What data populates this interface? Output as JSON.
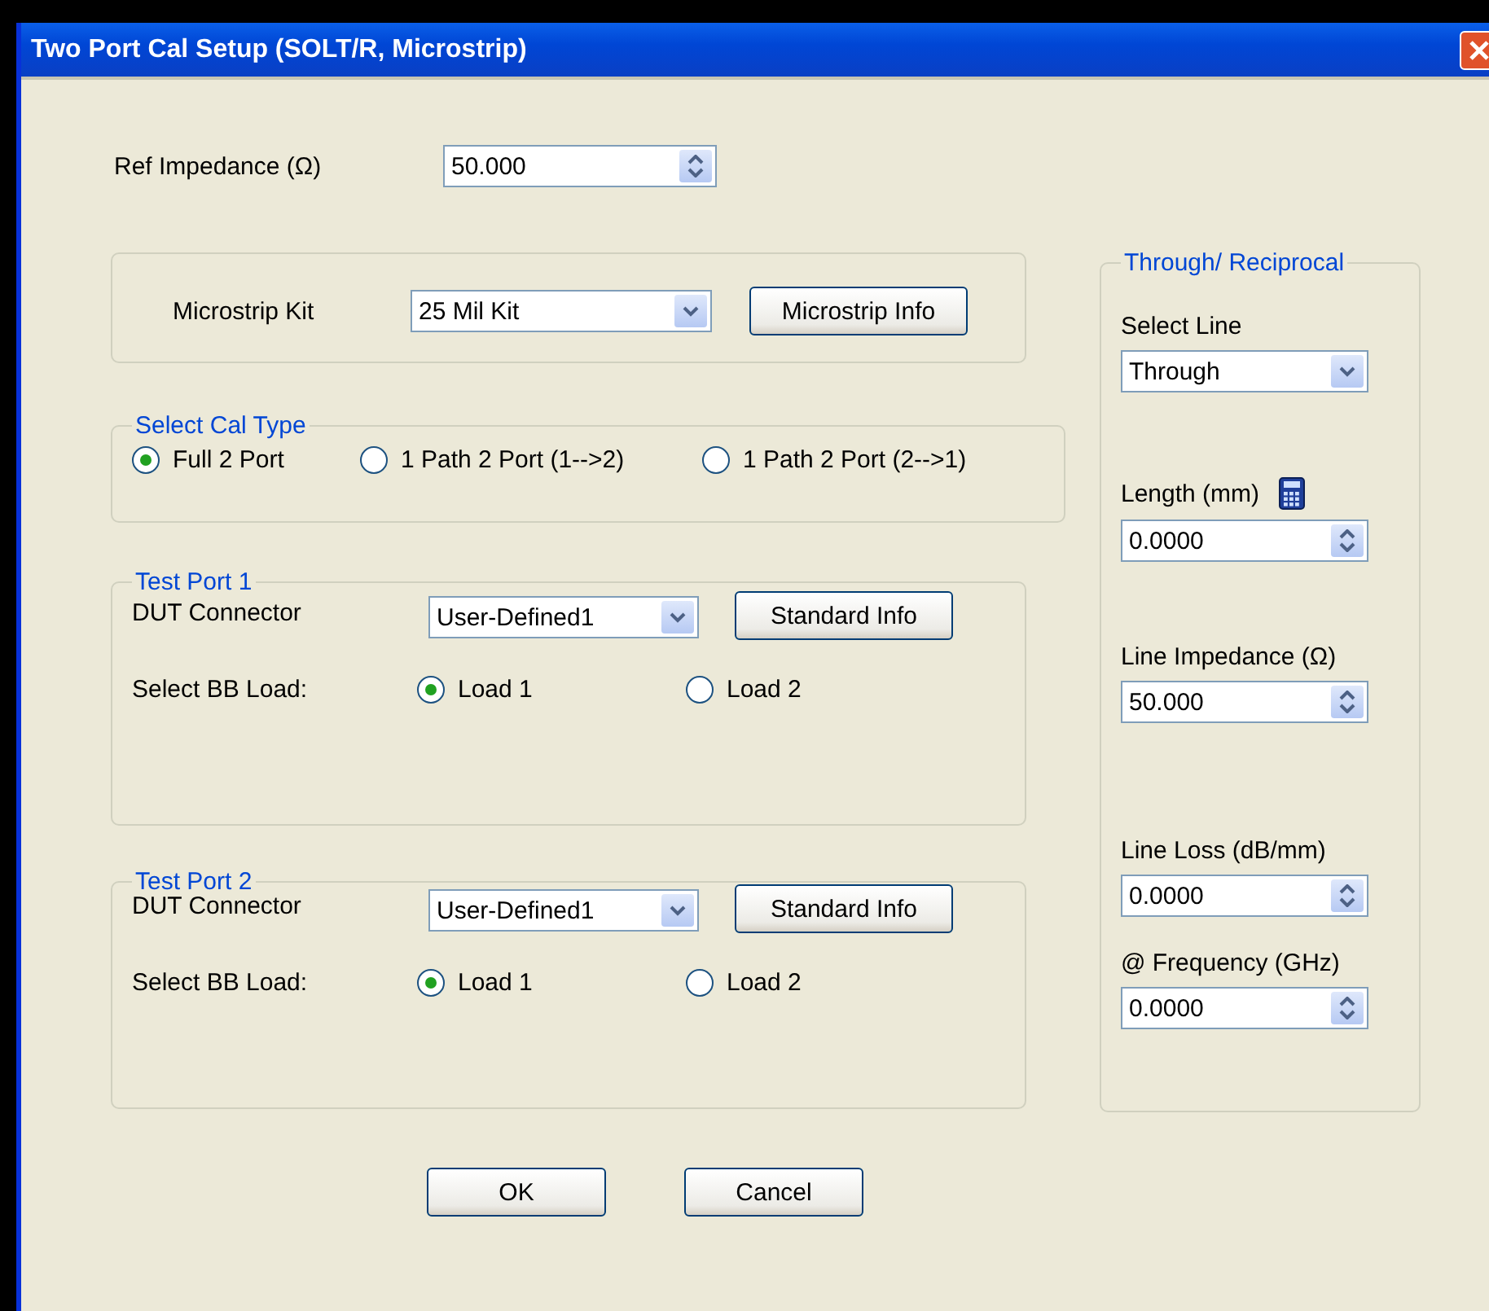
{
  "window": {
    "title": "Two Port Cal Setup (SOLT/R, Microstrip)"
  },
  "ref_impedance": {
    "label": "Ref Impedance (Ω)",
    "value": "50.000"
  },
  "microstrip": {
    "label": "Microstrip Kit",
    "value": "25 Mil Kit",
    "button": "Microstrip Info"
  },
  "cal_type": {
    "title": "Select Cal Type",
    "options": [
      {
        "label": "Full 2 Port",
        "selected": true
      },
      {
        "label": "1 Path 2 Port (1-->2)",
        "selected": false
      },
      {
        "label": "1 Path 2 Port (2-->1)",
        "selected": false
      }
    ]
  },
  "test_ports": [
    {
      "title": "Test Port 1",
      "connector_label": "DUT Connector",
      "connector": "User-Defined1",
      "button": "Standard Info",
      "load_label": "Select BB Load:",
      "loads": [
        {
          "label": "Load 1",
          "selected": true
        },
        {
          "label": "Load 2",
          "selected": false
        }
      ]
    },
    {
      "title": "Test Port 2",
      "connector_label": "DUT Connector",
      "connector": "User-Defined1",
      "button": "Standard Info",
      "load_label": "Select BB Load:",
      "loads": [
        {
          "label": "Load 1",
          "selected": true
        },
        {
          "label": "Load 2",
          "selected": false
        }
      ]
    }
  ],
  "through": {
    "title": "Through/ Reciprocal",
    "fields": [
      {
        "kind": "select",
        "label": "Select Line",
        "value": "Through"
      },
      {
        "kind": "spin",
        "label": "Length (mm)",
        "value": "0.0000",
        "calculator": true
      },
      {
        "kind": "spin",
        "label": "Line Impedance (Ω)",
        "value": "50.000"
      },
      {
        "kind": "spin",
        "label": "Line Loss (dB/mm)",
        "value": "0.0000"
      },
      {
        "kind": "spin",
        "label": "@ Frequency (GHz)",
        "value": "0.0000"
      }
    ]
  },
  "buttons": [
    "OK",
    "Cancel"
  ]
}
